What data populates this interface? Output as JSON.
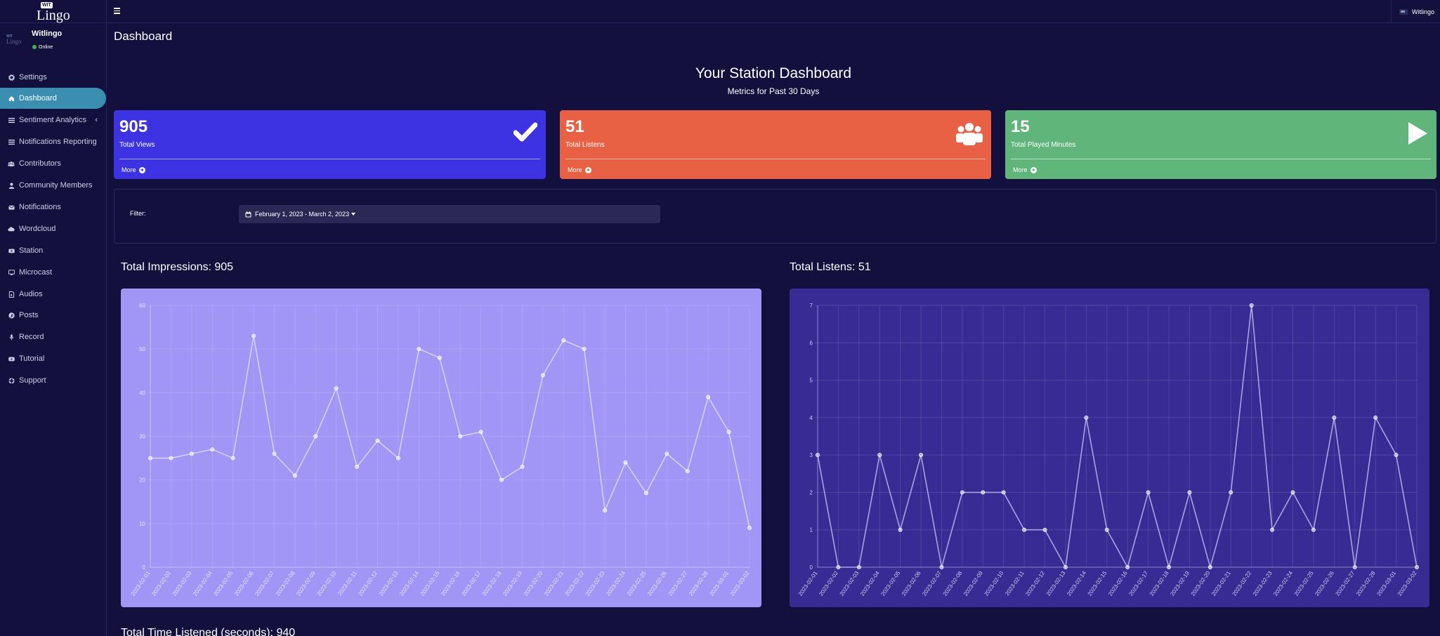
{
  "brand": {
    "badge": "WIT",
    "name": "Lingo"
  },
  "user": {
    "name": "Witlingo",
    "status": "Online",
    "avatar_badge": "WIT",
    "avatar_name": "Lingo"
  },
  "sidebar": {
    "items": [
      {
        "label": "Settings",
        "icon": "gear-icon"
      },
      {
        "label": "Dashboard",
        "icon": "home-icon",
        "active": true
      },
      {
        "label": "Sentiment Analytics",
        "icon": "bars-icon",
        "chevron": "‹"
      },
      {
        "label": "Notifications Reporting",
        "icon": "bars-icon"
      },
      {
        "label": "Contributors",
        "icon": "users-icon"
      },
      {
        "label": "Community Members",
        "icon": "user-icon"
      },
      {
        "label": "Notifications",
        "icon": "envelope-icon"
      },
      {
        "label": "Wordcloud",
        "icon": "cloud-icon"
      },
      {
        "label": "Station",
        "icon": "youtube-icon"
      },
      {
        "label": "Microcast",
        "icon": "desktop-icon"
      },
      {
        "label": "Audios",
        "icon": "file-audio-icon"
      },
      {
        "label": "Posts",
        "icon": "pinterest-icon"
      },
      {
        "label": "Record",
        "icon": "microphone-icon"
      },
      {
        "label": "Tutorial",
        "icon": "youtube-icon"
      },
      {
        "label": "Support",
        "icon": "life-ring-icon"
      }
    ]
  },
  "topbar": {
    "user_name": "Witlingo"
  },
  "page": {
    "title": "Dashboard",
    "heading": "Your Station Dashboard",
    "subheading": "Metrics for Past 30 Days"
  },
  "boxes": [
    {
      "value": "905",
      "label": "Total Views",
      "more": "More",
      "color": "#3d33e3",
      "icon": "check-icon"
    },
    {
      "value": "51",
      "label": "Total Listens",
      "more": "More",
      "color": "#e86144",
      "icon": "users-icon"
    },
    {
      "value": "15",
      "label": "Total Played Minutes",
      "more": "More",
      "color": "#5fb57a",
      "icon": "play-icon"
    }
  ],
  "filter": {
    "label": "Filter:",
    "range": "February 1, 2023 - March 2, 2023"
  },
  "sections": {
    "impressions_title": "Total Impressions: 905",
    "listens_title": "Total Listens: 51",
    "time_title": "Total Time Listened (seconds): 940"
  },
  "chart_data": [
    {
      "type": "line",
      "title": "Total Impressions: 905",
      "x": [
        "2023-02-01",
        "2023-02-02",
        "2023-02-03",
        "2023-02-04",
        "2023-02-05",
        "2023-02-06",
        "2023-02-07",
        "2023-02-08",
        "2023-02-09",
        "2023-02-10",
        "2023-02-11",
        "2023-02-12",
        "2023-02-13",
        "2023-02-14",
        "2023-02-15",
        "2023-02-16",
        "2023-02-17",
        "2023-02-18",
        "2023-02-19",
        "2023-02-20",
        "2023-02-21",
        "2023-02-22",
        "2023-02-23",
        "2023-02-24",
        "2023-02-25",
        "2023-02-26",
        "2023-02-27",
        "2023-02-28",
        "2023-03-01",
        "2023-03-02"
      ],
      "values": [
        25,
        25,
        26,
        27,
        25,
        53,
        26,
        21,
        30,
        41,
        23,
        29,
        25,
        50,
        48,
        30,
        31,
        20,
        23,
        44,
        52,
        50,
        13,
        24,
        17,
        26,
        22,
        39,
        31,
        9
      ],
      "yticks": [
        0,
        10,
        20,
        30,
        40,
        50,
        60
      ],
      "ylim": [
        0,
        60
      ],
      "grid": true,
      "background": "#a196f5",
      "line_color": "#d4d0f8"
    },
    {
      "type": "line",
      "title": "Total Listens: 51",
      "x": [
        "2023-02-01",
        "2023-02-02",
        "2023-02-03",
        "2023-02-04",
        "2023-02-05",
        "2023-02-06",
        "2023-02-07",
        "2023-02-08",
        "2023-02-09",
        "2023-02-10",
        "2023-02-11",
        "2023-02-12",
        "2023-02-13",
        "2023-02-14",
        "2023-02-15",
        "2023-02-16",
        "2023-02-17",
        "2023-02-18",
        "2023-02-19",
        "2023-02-20",
        "2023-02-21",
        "2023-02-22",
        "2023-02-23",
        "2023-02-24",
        "2023-02-25",
        "2023-02-26",
        "2023-02-27",
        "2023-02-28",
        "2023-03-01",
        "2023-03-02"
      ],
      "values": [
        3,
        0,
        0,
        3,
        1,
        3,
        0,
        2,
        2,
        2,
        1,
        1,
        0,
        4,
        1,
        0,
        2,
        0,
        2,
        0,
        2,
        7,
        1,
        2,
        1,
        4,
        0,
        4,
        3,
        0
      ],
      "yticks": [
        0,
        1,
        2,
        3,
        4,
        5,
        6,
        7
      ],
      "ylim": [
        0,
        7
      ],
      "grid": true,
      "background": "#382b94",
      "line_color": "#a9a3e0"
    }
  ]
}
